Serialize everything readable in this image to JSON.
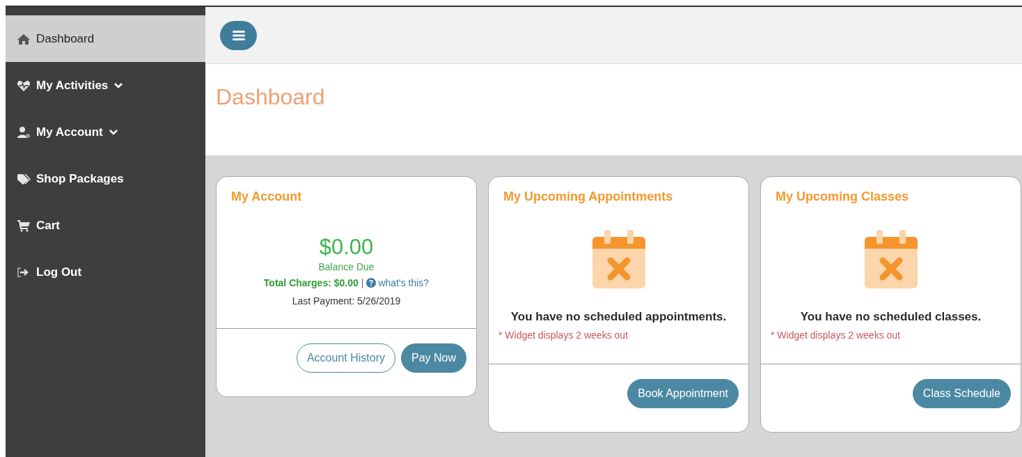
{
  "sidebar": {
    "items": [
      {
        "label": "Dashboard",
        "selected": true,
        "expandable": false
      },
      {
        "label": "My Activities",
        "selected": false,
        "expandable": true
      },
      {
        "label": "My Account",
        "selected": false,
        "expandable": true
      },
      {
        "label": "Shop Packages",
        "selected": false,
        "expandable": false
      },
      {
        "label": "Cart",
        "selected": false,
        "expandable": false
      },
      {
        "label": "Log Out",
        "selected": false,
        "expandable": false
      }
    ]
  },
  "page": {
    "title": "Dashboard"
  },
  "cards": [
    {
      "kind": "account",
      "title": "My Account",
      "amount": "$0.00",
      "amount_label": "Balance Due",
      "total_charges": "Total Charges: $0.00",
      "separator": "|",
      "help_link": "what's this?",
      "last_payment": "Last Payment: 5/26/2019",
      "buttons": [
        {
          "label": "Account History",
          "kind": "outline"
        },
        {
          "label": "Pay Now",
          "kind": "filled"
        }
      ]
    },
    {
      "kind": "empty",
      "title": "My Upcoming Appointments",
      "message": "You have no scheduled appointments.",
      "note": "* Widget displays 2 weeks out",
      "buttons": [
        {
          "label": "Book Appointment",
          "kind": "filled"
        }
      ]
    },
    {
      "kind": "empty",
      "title": "My Upcoming Classes",
      "message": "You have no scheduled classes.",
      "note": "* Widget displays 2 weeks out",
      "buttons": [
        {
          "label": "Class Schedule",
          "kind": "filled"
        }
      ]
    }
  ]
}
